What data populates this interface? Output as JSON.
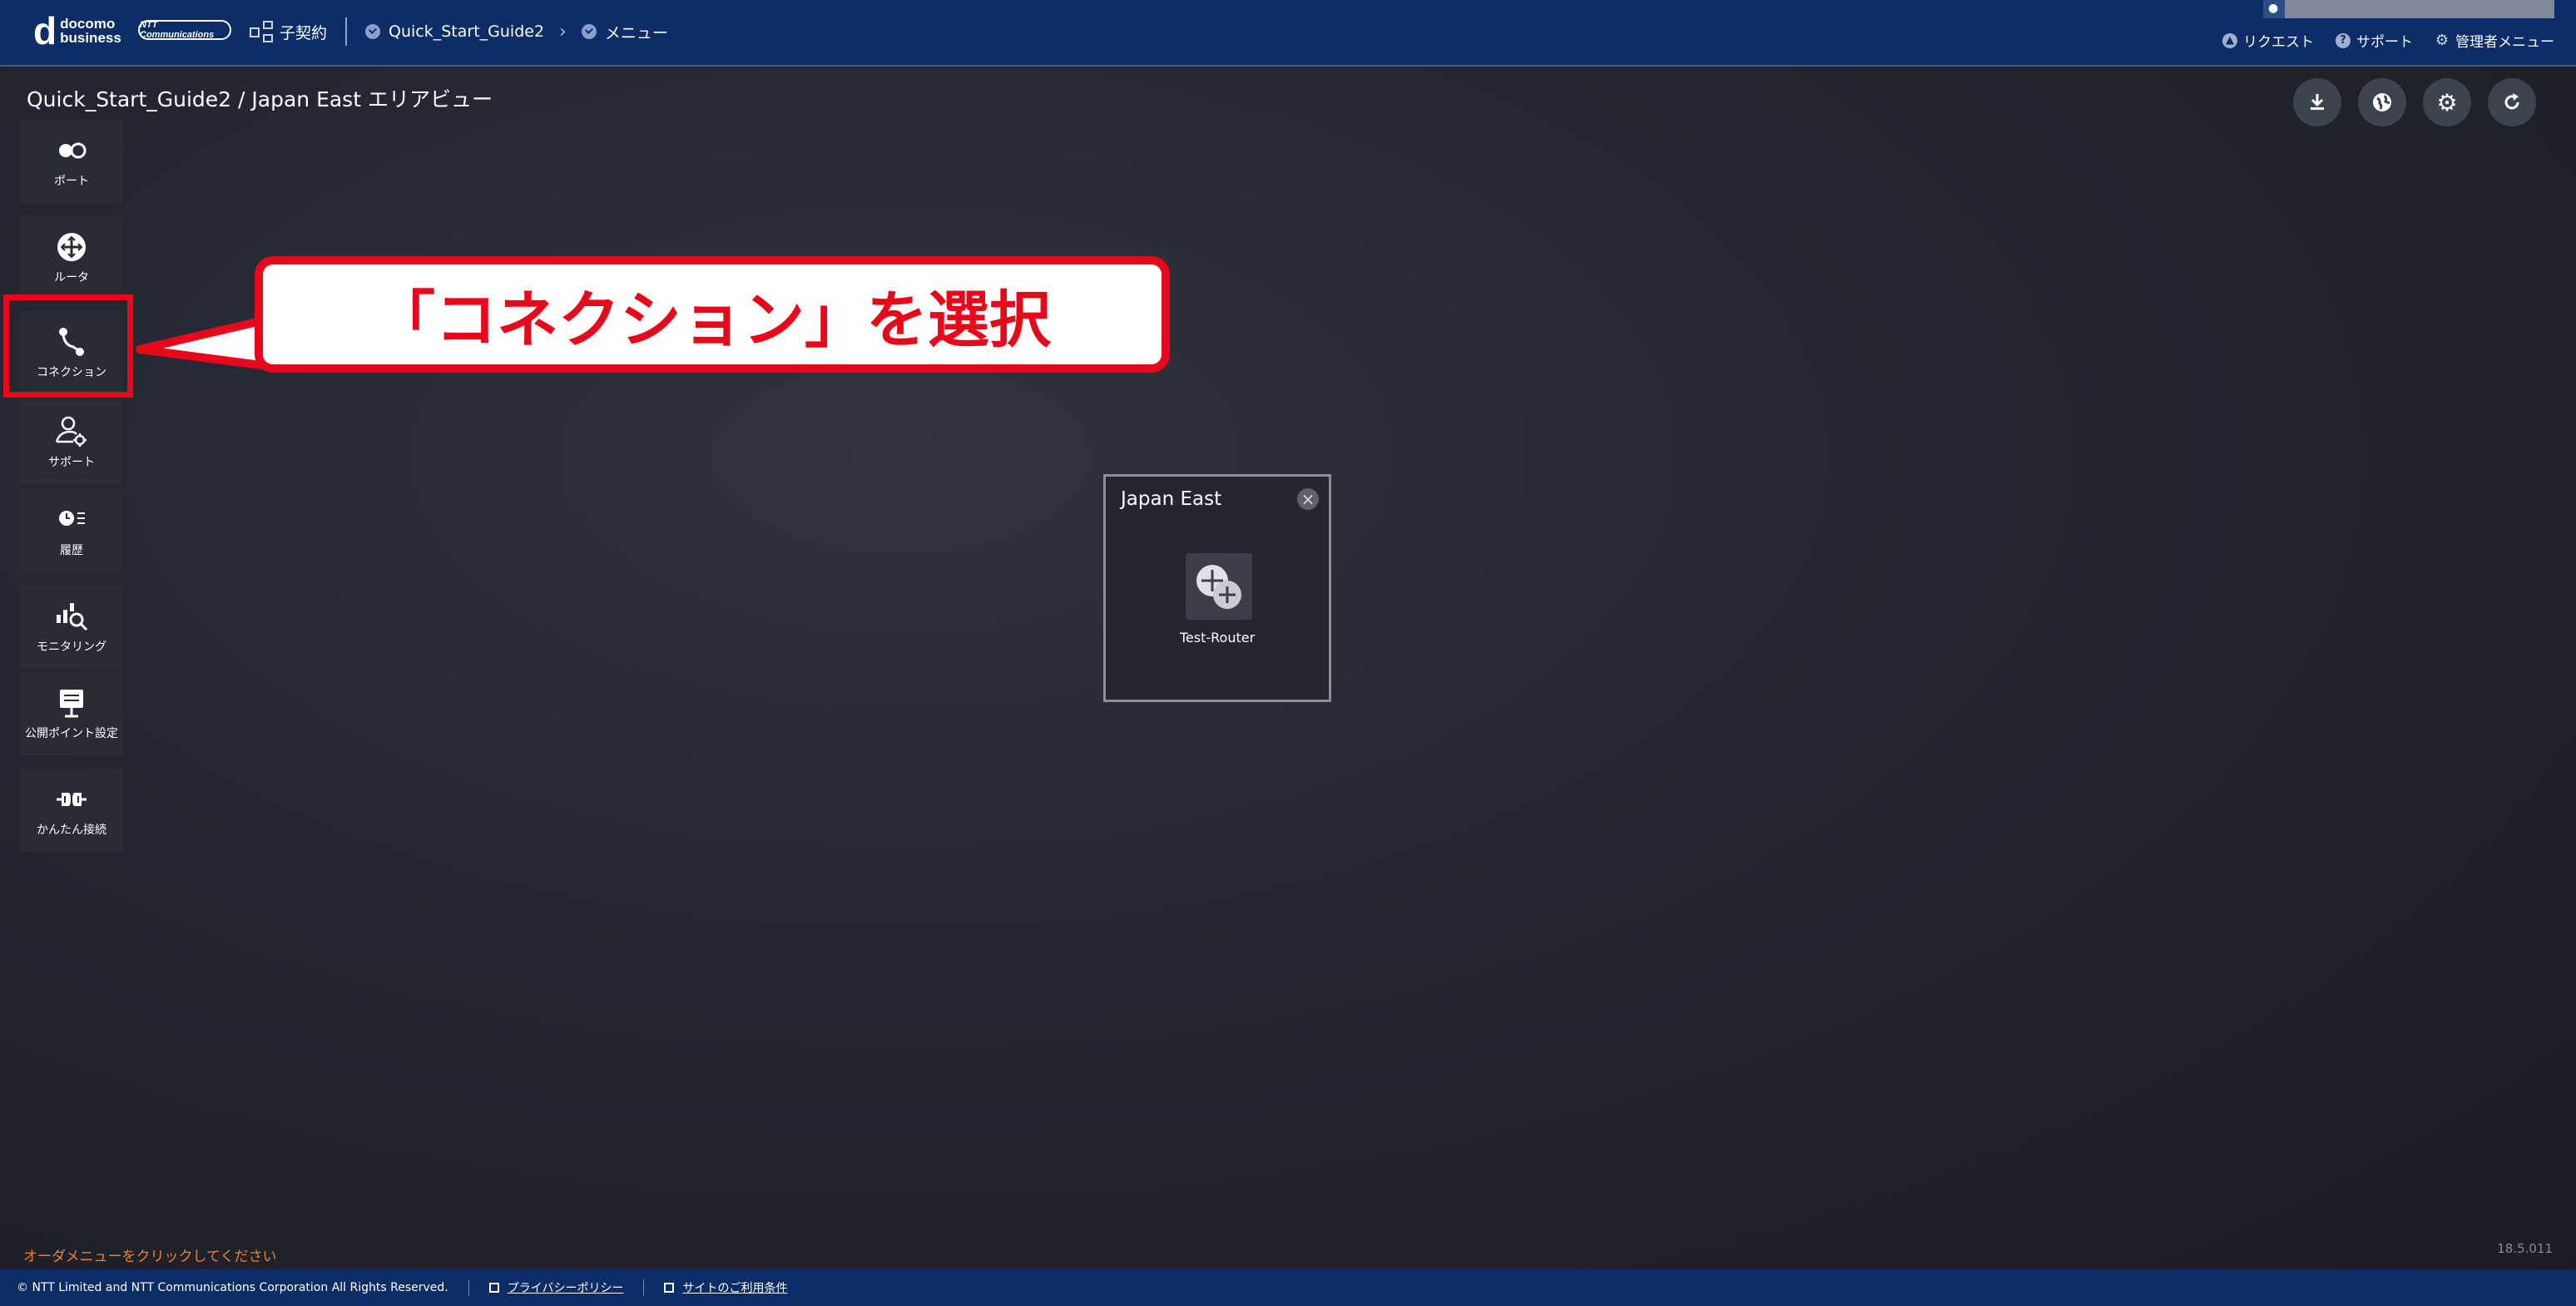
{
  "header": {
    "brand_top": "docomo",
    "brand_bottom": "business",
    "ntt_logo": "NTT Communications",
    "breadcrumbs": [
      {
        "label": "子契約"
      },
      {
        "label": "Quick_Start_Guide2"
      },
      {
        "label": "メニュー"
      }
    ],
    "links": [
      {
        "label": "リクエスト",
        "icon": "bell-icon"
      },
      {
        "label": "サポート",
        "icon": "help-icon"
      },
      {
        "label": "管理者メニュー",
        "icon": "gear-icon"
      }
    ]
  },
  "page": {
    "title": "Quick_Start_Guide2 / Japan East エリアビュー"
  },
  "sidebar": {
    "items": [
      {
        "label": "ポート",
        "icon": "port-icon"
      },
      {
        "label": "ルータ",
        "icon": "router-icon"
      },
      {
        "label": "コネクション",
        "icon": "connection-icon"
      },
      {
        "label": "サポート",
        "icon": "support-icon"
      },
      {
        "label": "履歴",
        "icon": "history-icon"
      },
      {
        "label": "モニタリング",
        "icon": "monitoring-icon"
      },
      {
        "label": "公開ポイント設定",
        "icon": "public-point-icon"
      },
      {
        "label": "かんたん接続",
        "icon": "easy-connect-icon"
      }
    ]
  },
  "toolbar": {
    "buttons": [
      "download-icon",
      "globe-icon",
      "settings-icon",
      "refresh-icon"
    ]
  },
  "callout": {
    "text": "「コネクション」を選択"
  },
  "area": {
    "title": "Japan East",
    "router_label": "Test-Router"
  },
  "status": {
    "order_message": "オーダメニューをクリックしてください",
    "version": "18.5.011"
  },
  "footer": {
    "copyright": "© NTT Limited and NTT Communications Corporation All Rights Reserved.",
    "privacy": "プライバシーポリシー",
    "terms": "サイトのご利用条件"
  },
  "colors": {
    "header": "#0d2d68",
    "accent_red": "#e8081a",
    "order_text": "#f47f2c"
  }
}
